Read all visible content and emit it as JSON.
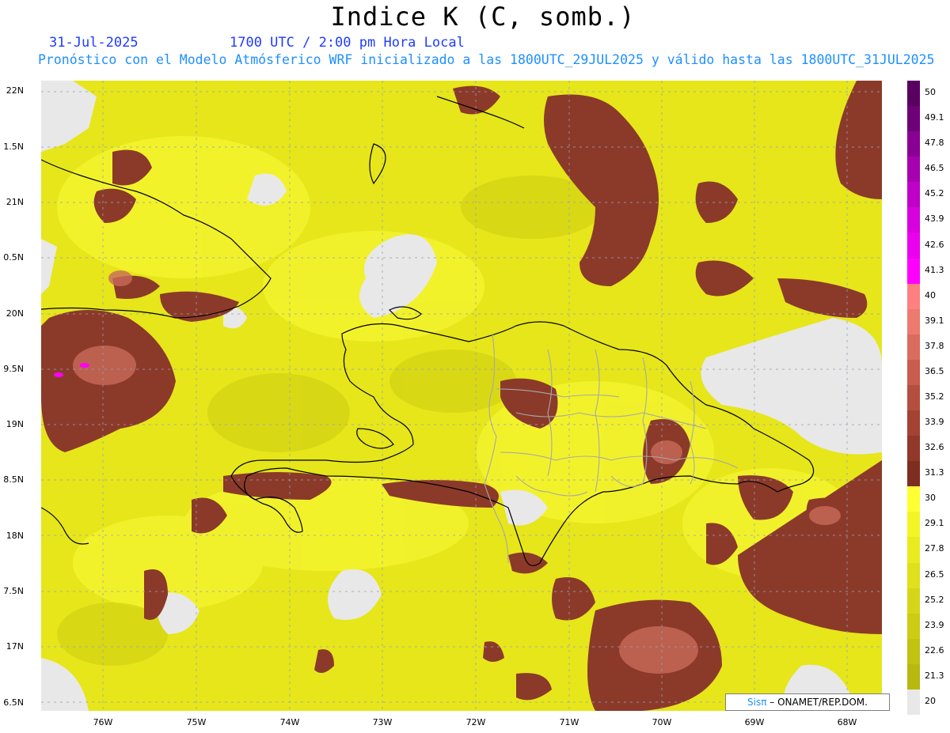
{
  "header": {
    "title": "Indice K (C, somb.)",
    "date": "31-Jul-2025",
    "valid_time": "1700 UTC / 2:00 pm Hora Local",
    "subtitle": "Pronóstico con el Modelo Atmósferico WRF inicializado a las 1800UTC_29JUL2025 y válido hasta las  1800UTC_31JUL2025"
  },
  "map": {
    "y_labels": [
      "22N",
      "1.5N",
      "21N",
      "0.5N",
      "20N",
      "9.5N",
      "19N",
      "8.5N",
      "18N",
      "7.5N",
      "17N",
      "6.5N"
    ],
    "x_labels": [
      "76W",
      "75W",
      "74W",
      "73W",
      "72W",
      "71W",
      "70W",
      "69W",
      "68W"
    ],
    "colors": {
      "background_low": "#e8e8e8",
      "field_base": "#e6e61a",
      "high_k": "#8b3a2a",
      "extreme": "#ff00ff"
    }
  },
  "colorbar": {
    "labels": [
      "50",
      "49.1",
      "47.8",
      "46.5",
      "45.2",
      "43.9",
      "42.6",
      "41.3",
      "40",
      "39.1",
      "37.8",
      "36.5",
      "35.2",
      "33.9",
      "32.6",
      "31.3",
      "30",
      "29.1",
      "27.8",
      "26.5",
      "25.2",
      "23.9",
      "22.6",
      "21.3",
      "20"
    ],
    "colors": [
      "#5a0060",
      "#6e0078",
      "#8a0094",
      "#a600b0",
      "#c000c8",
      "#d800de",
      "#ea00ee",
      "#ff00ff",
      "#ff8080",
      "#ec7a6e",
      "#da6c5e",
      "#c85c4e",
      "#b64e40",
      "#a44234",
      "#92382a",
      "#7e2e20",
      "#ffff33",
      "#f4f426",
      "#eaea20",
      "#e0e01c",
      "#d6d618",
      "#cccc14",
      "#c2c212",
      "#b8b810",
      "#e8e8e8"
    ]
  },
  "credit": {
    "brand": "Sisπ",
    "org": " – ONAMET/REP.DOM."
  }
}
